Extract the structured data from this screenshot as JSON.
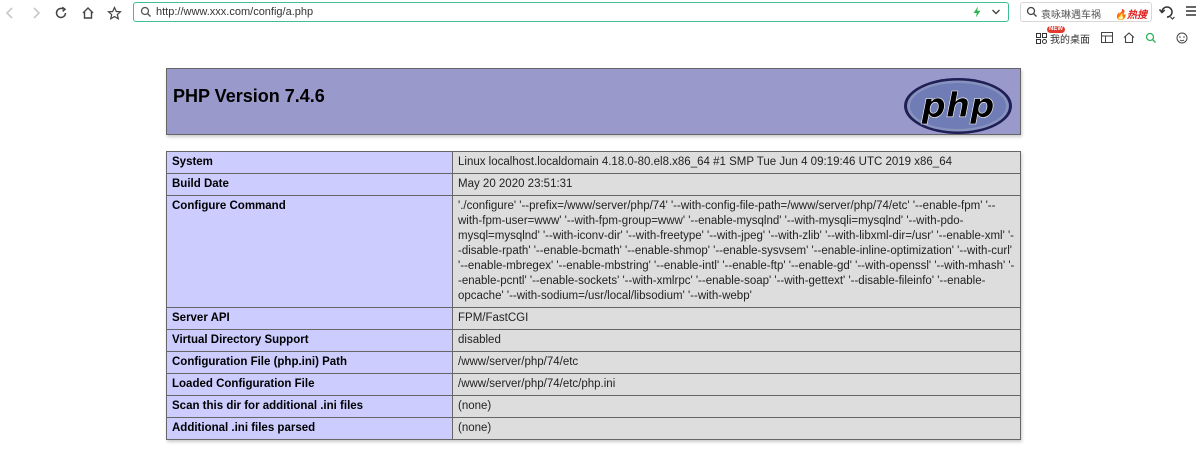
{
  "browser": {
    "url": "http://www.xxx.com/config/a.php",
    "search_text": "袁咏琳遇车祸",
    "search_hot": "热搜",
    "desk_label": "我的桌面",
    "new_badge": "NEW"
  },
  "php": {
    "title": "PHP Version 7.4.6",
    "logo_text": "php",
    "rows": [
      {
        "key": "System",
        "value": "Linux localhost.localdomain 4.18.0-80.el8.x86_64 #1 SMP Tue Jun 4 09:19:46 UTC 2019 x86_64"
      },
      {
        "key": "Build Date",
        "value": "May 20 2020 23:51:31"
      },
      {
        "key": "Configure Command",
        "value": "'./configure' '--prefix=/www/server/php/74' '--with-config-file-path=/www/server/php/74/etc' '--enable-fpm' '--with-fpm-user=www' '--with-fpm-group=www' '--enable-mysqlnd' '--with-mysqli=mysqlnd' '--with-pdo-mysql=mysqlnd' '--with-iconv-dir' '--with-freetype' '--with-jpeg' '--with-zlib' '--with-libxml-dir=/usr' '--enable-xml' '--disable-rpath' '--enable-bcmath' '--enable-shmop' '--enable-sysvsem' '--enable-inline-optimization' '--with-curl' '--enable-mbregex' '--enable-mbstring' '--enable-intl' '--enable-ftp' '--enable-gd' '--with-openssl' '--with-mhash' '--enable-pcntl' '--enable-sockets' '--with-xmlrpc' '--enable-soap' '--with-gettext' '--disable-fileinfo' '--enable-opcache' '--with-sodium=/usr/local/libsodium' '--with-webp'"
      },
      {
        "key": "Server API",
        "value": "FPM/FastCGI"
      },
      {
        "key": "Virtual Directory Support",
        "value": "disabled"
      },
      {
        "key": "Configuration File (php.ini) Path",
        "value": "/www/server/php/74/etc"
      },
      {
        "key": "Loaded Configuration File",
        "value": "/www/server/php/74/etc/php.ini"
      },
      {
        "key": "Scan this dir for additional .ini files",
        "value": "(none)"
      },
      {
        "key": "Additional .ini files parsed",
        "value": "(none)"
      }
    ]
  },
  "icons": {
    "back": "back-arrow-icon",
    "forward": "forward-arrow-icon",
    "reload": "reload-icon",
    "home": "home-icon",
    "star": "star-icon"
  },
  "colors": {
    "header_bg": "#9999cc",
    "key_bg": "#ccccff",
    "value_bg": "#dddddd",
    "url_border": "#3fbf8f"
  }
}
